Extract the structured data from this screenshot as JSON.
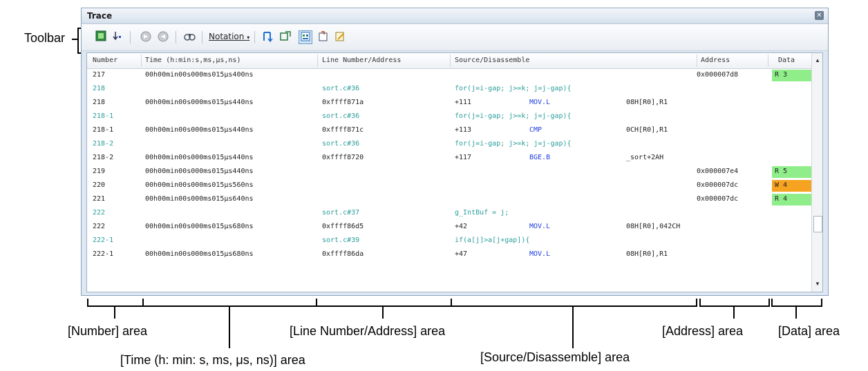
{
  "annotations": {
    "toolbar": "Toolbar",
    "number_area": "[Number] area",
    "time_area": "[Time (h: min: s, ms, μs, ns)] area",
    "line_area": "[Line Number/Address] area",
    "source_area": "[Source/Disassemble] area",
    "address_area": "[Address] area",
    "data_area": "[Data] area"
  },
  "window": {
    "title": "Trace",
    "close_icon": "close-icon"
  },
  "toolbar": {
    "notation_label": "Notation",
    "icons": [
      "acquire-trace-icon",
      "step-icon",
      "forward-icon",
      "backward-icon",
      "find-icon",
      "notation-dropdown-icon",
      "link-icon",
      "mix-display-icon",
      "source-view-icon",
      "refresh-icon",
      "save-icon"
    ]
  },
  "columns": [
    "Number",
    "Time (h:min:s,ms,μs,ns)",
    "Line Number/Address",
    "Source/Disassemble",
    "Address",
    "Data"
  ],
  "rows": [
    {
      "num": "217",
      "time": "00h00min00s000ms015μs400ns",
      "line": "",
      "src": "",
      "addr": "0x000007d8",
      "data": "R 3",
      "data_color": "#8fee8a",
      "kind": "data"
    },
    {
      "num": "218",
      "time": "",
      "line": "sort.c#36",
      "src": "for(j=i-gap; j>=k; j=j-gap){",
      "addr": "",
      "data": "",
      "kind": "source"
    },
    {
      "num": "218",
      "time": "00h00min00s000ms015μs440ns",
      "line": "0xffff871a",
      "src": "+111",
      "mnem": "MOV.L",
      "oper": "08H[R0],R1",
      "addr": "",
      "data": "",
      "kind": "asm"
    },
    {
      "num": "218-1",
      "time": "",
      "line": "sort.c#36",
      "src": "for(j=i-gap; j>=k; j=j-gap){",
      "addr": "",
      "data": "",
      "kind": "source"
    },
    {
      "num": "218-1",
      "time": "00h00min00s000ms015μs440ns",
      "line": "0xffff871c",
      "src": "+113",
      "mnem": "CMP",
      "oper": "0CH[R0],R1",
      "addr": "",
      "data": "",
      "kind": "asm"
    },
    {
      "num": "218-2",
      "time": "",
      "line": "sort.c#36",
      "src": "for(j=i-gap; j>=k; j=j-gap){",
      "addr": "",
      "data": "",
      "kind": "source"
    },
    {
      "num": "218-2",
      "time": "00h00min00s000ms015μs440ns",
      "line": "0xffff8720",
      "src": "+117",
      "mnem": "BGE.B",
      "oper": "_sort+2AH",
      "addr": "",
      "data": "",
      "kind": "asm"
    },
    {
      "num": "219",
      "time": "00h00min00s000ms015μs440ns",
      "line": "",
      "src": "",
      "addr": "0x000007e4",
      "data": "R 5",
      "data_color": "#8fee8a",
      "kind": "data"
    },
    {
      "num": "220",
      "time": "00h00min00s000ms015μs560ns",
      "line": "",
      "src": "",
      "addr": "0x000007dc",
      "data": "W 4",
      "data_color": "#f5a321",
      "kind": "data"
    },
    {
      "num": "221",
      "time": "00h00min00s000ms015μs640ns",
      "line": "",
      "src": "",
      "addr": "0x000007dc",
      "data": "R 4",
      "data_color": "#8fee8a",
      "kind": "data"
    },
    {
      "num": "222",
      "time": "",
      "line": "sort.c#37",
      "src": "g_IntBuf = j;",
      "addr": "",
      "data": "",
      "kind": "source"
    },
    {
      "num": "222",
      "time": "00h00min00s000ms015μs680ns",
      "line": "0xffff86d5",
      "src": "+42",
      "mnem": "MOV.L",
      "oper": "08H[R0],042CH",
      "addr": "",
      "data": "",
      "kind": "asm"
    },
    {
      "num": "222-1",
      "time": "",
      "line": "sort.c#39",
      "src": "if(a[j]>a[j+gap]){",
      "addr": "",
      "data": "",
      "kind": "source"
    },
    {
      "num": "222-1",
      "time": "00h00min00s000ms015μs680ns",
      "line": "0xffff86da",
      "src": "+47",
      "mnem": "MOV.L",
      "oper": "08H[R0],R1",
      "addr": "",
      "data": "",
      "kind": "asm"
    }
  ]
}
